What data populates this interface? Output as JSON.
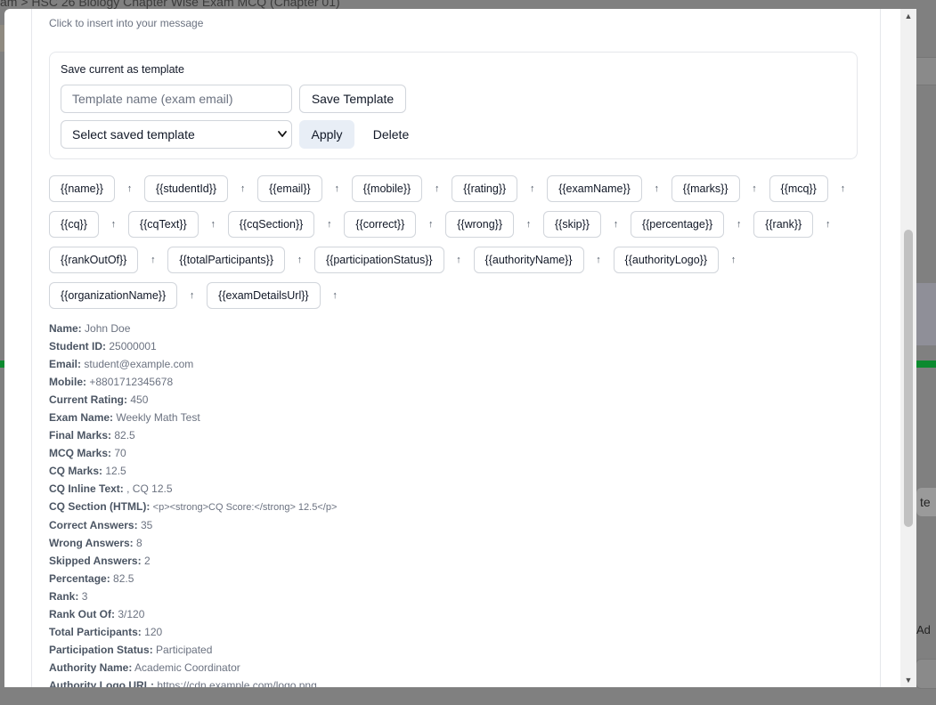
{
  "background": {
    "breadcrumb": "am  >  HSC 26 Biology Chapter Wise Exam MCQ (Chapter 01)",
    "right_button_label": "te",
    "right_label": "Ad"
  },
  "hint": "Click to insert into your message",
  "template": {
    "section_title": "Save current as template",
    "name_placeholder": "Template name (exam email)",
    "save_label": "Save Template",
    "select_value": "Select saved template",
    "apply_label": "Apply",
    "delete_label": "Delete"
  },
  "insert_arrow": "↑",
  "placeholders": [
    [
      "{{name}}",
      "{{studentId}}",
      "{{email}}",
      "{{mobile}}",
      "{{rating}}",
      "{{examName}}",
      "{{marks}}",
      "{{mcq}}"
    ],
    [
      "{{cq}}",
      "{{cqText}}",
      "{{cqSection}}",
      "{{correct}}",
      "{{wrong}}",
      "{{skip}}",
      "{{percentage}}",
      "{{rank}}"
    ],
    [
      "{{rankOutOf}}",
      "{{totalParticipants}}",
      "{{participationStatus}}",
      "{{authorityName}}",
      "{{authorityLogo}}"
    ],
    [
      "{{organizationName}}",
      "{{examDetailsUrl}}"
    ]
  ],
  "preview": [
    {
      "k": "Name:",
      "v": "John Doe"
    },
    {
      "k": "Student ID:",
      "v": "25000001"
    },
    {
      "k": "Email:",
      "v": "student@example.com"
    },
    {
      "k": "Mobile:",
      "v": "+8801712345678"
    },
    {
      "k": "Current Rating:",
      "v": "450"
    },
    {
      "k": "Exam Name:",
      "v": "Weekly Math Test"
    },
    {
      "k": "Final Marks:",
      "v": "82.5"
    },
    {
      "k": "MCQ Marks:",
      "v": "70"
    },
    {
      "k": "CQ Marks:",
      "v": "12.5"
    },
    {
      "k": "CQ Inline Text:",
      "v": ", CQ 12.5"
    },
    {
      "k": "CQ Section (HTML):",
      "v": "<p><strong>CQ Score:</strong> 12.5</p>"
    },
    {
      "k": "Correct Answers:",
      "v": "35"
    },
    {
      "k": "Wrong Answers:",
      "v": "8"
    },
    {
      "k": "Skipped Answers:",
      "v": "2"
    },
    {
      "k": "Percentage:",
      "v": "82.5"
    },
    {
      "k": "Rank:",
      "v": "3"
    },
    {
      "k": "Rank Out Of:",
      "v": "3/120"
    },
    {
      "k": "Total Participants:",
      "v": "120"
    },
    {
      "k": "Participation Status:",
      "v": "Participated"
    },
    {
      "k": "Authority Name:",
      "v": "Academic Coordinator"
    },
    {
      "k": "Authority Logo URL:",
      "v": "https://cdn.example.com/logo.png"
    }
  ]
}
